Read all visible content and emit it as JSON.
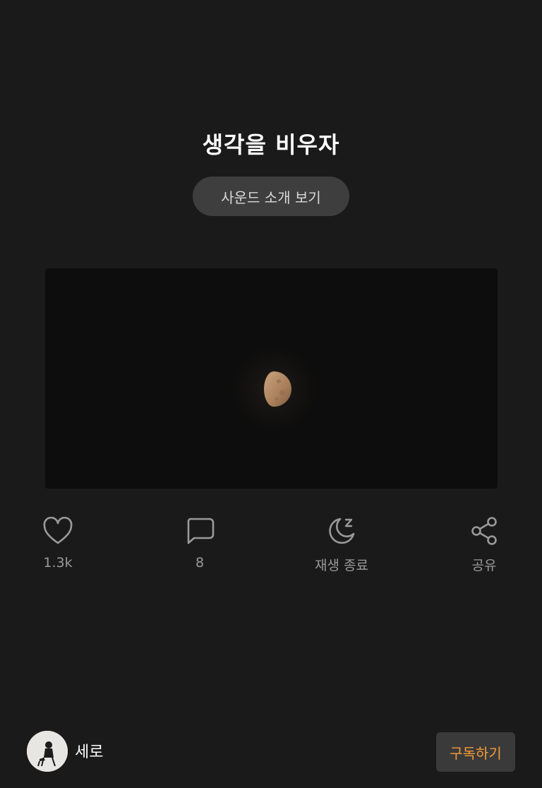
{
  "sound": {
    "title": "생각을 비우자",
    "intro_label": "사운드 소개 보기"
  },
  "actions": [
    {
      "icon": "heart-icon",
      "label": "1.3k"
    },
    {
      "icon": "comment-icon",
      "label": "8"
    },
    {
      "icon": "moon-sleep-icon",
      "label": "재생 종료"
    },
    {
      "icon": "share-icon",
      "label": "공유"
    }
  ],
  "creator": {
    "name": "세로"
  },
  "subscribe": {
    "label": "구독하기"
  },
  "colors": {
    "background": "#1a1a1a",
    "accent": "#f29a3a",
    "icon": "#9a9a9a"
  }
}
